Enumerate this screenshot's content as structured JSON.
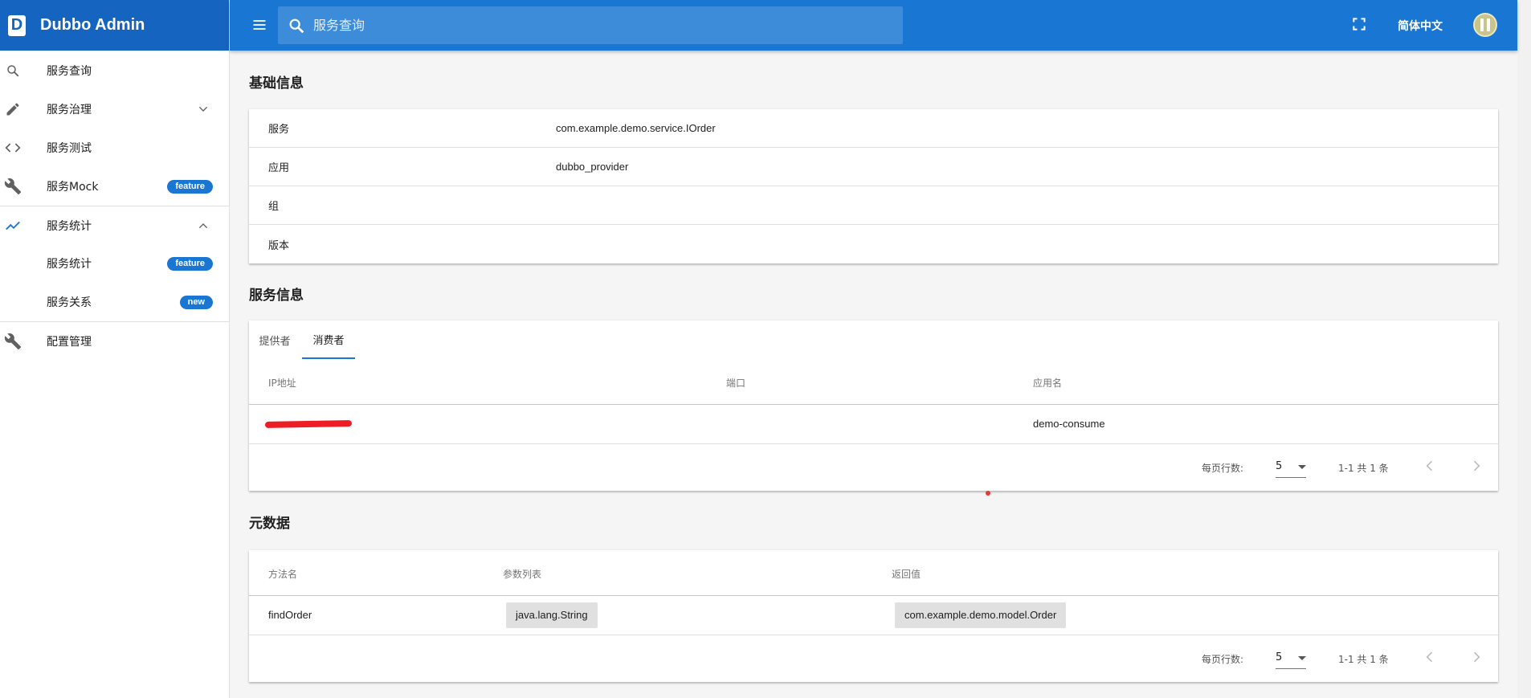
{
  "brand": {
    "logo_letter": "D",
    "title": "Dubbo Admin"
  },
  "sidebar": {
    "items": [
      {
        "label": "服务查询",
        "icon": "search-icon"
      },
      {
        "label": "服务治理",
        "icon": "pencil-icon",
        "expandable": true,
        "expanded": false
      },
      {
        "label": "服务测试",
        "icon": "code-icon"
      },
      {
        "label": "服务Mock",
        "icon": "wrench-icon",
        "badge": "feature"
      },
      {
        "label": "服务统计",
        "icon": "trending-up-icon",
        "expandable": true,
        "expanded": true,
        "active": true
      },
      {
        "label": "服务统计",
        "child": true,
        "badge": "feature"
      },
      {
        "label": "服务关系",
        "child": true,
        "badge": "new"
      },
      {
        "label": "配置管理",
        "icon": "wrench-icon"
      }
    ]
  },
  "topbar": {
    "search_placeholder": "服务查询",
    "language": "简体中文"
  },
  "colors": {
    "primary": "#1976d2",
    "brand_bg": "#1565c0",
    "badge": "#1976d2",
    "redaction": "#ee1c24"
  },
  "basic_info": {
    "title": "基础信息",
    "rows": [
      {
        "key": "服务",
        "value": "com.example.demo.service.IOrder"
      },
      {
        "key": "应用",
        "value": "dubbo_provider"
      },
      {
        "key": "组",
        "value": ""
      },
      {
        "key": "版本",
        "value": ""
      }
    ]
  },
  "service_info": {
    "title": "服务信息",
    "tabs": [
      {
        "label": "提供者",
        "active": false
      },
      {
        "label": "消费者",
        "active": true
      }
    ],
    "columns": [
      "IP地址",
      "端口",
      "应用名"
    ],
    "rows": [
      {
        "ip": "",
        "port": "",
        "app": "demo-consume"
      }
    ],
    "pager": {
      "rows_label": "每页行数:",
      "rows_per_page": "5",
      "range": "1-1 共 1 条"
    }
  },
  "metadata": {
    "title": "元数据",
    "columns": [
      "方法名",
      "参数列表",
      "返回值"
    ],
    "rows": [
      {
        "method": "findOrder",
        "params": "java.lang.String",
        "return": "com.example.demo.model.Order"
      }
    ],
    "pager": {
      "rows_label": "每页行数:",
      "rows_per_page": "5",
      "range": "1-1 共 1 条"
    }
  }
}
